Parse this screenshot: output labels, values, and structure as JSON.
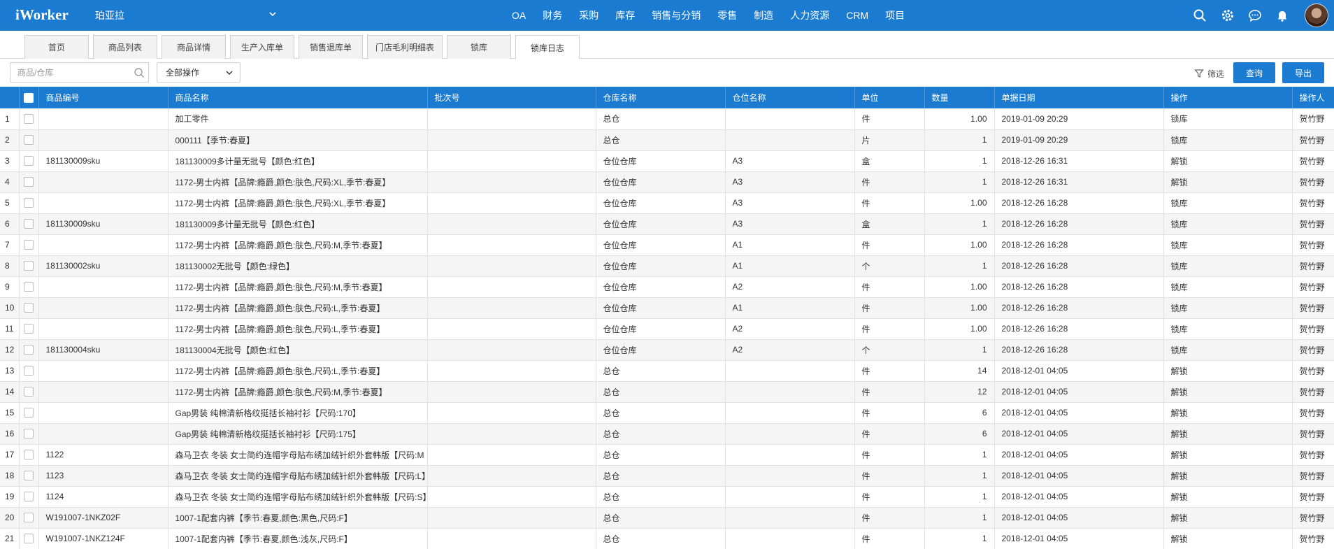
{
  "app": {
    "logo": "iWorker",
    "company": "珀亚拉",
    "nav": [
      "OA",
      "财务",
      "采购",
      "库存",
      "销售与分销",
      "零售",
      "制造",
      "人力资源",
      "CRM",
      "项目"
    ]
  },
  "tabs": [
    {
      "label": "首页",
      "active": false
    },
    {
      "label": "商品列表",
      "active": false
    },
    {
      "label": "商品详情",
      "active": false
    },
    {
      "label": "生产入库单",
      "active": false
    },
    {
      "label": "销售退库单",
      "active": false
    },
    {
      "label": "门店毛利明细表",
      "active": false
    },
    {
      "label": "锁库",
      "active": false
    },
    {
      "label": "锁库日志",
      "active": true
    }
  ],
  "toolbar": {
    "search_placeholder": "商品/仓库",
    "operation_select": "全部操作",
    "filter_label": "筛选",
    "query_label": "查询",
    "export_label": "导出"
  },
  "table": {
    "columns": [
      "商品编号",
      "商品名称",
      "批次号",
      "仓库名称",
      "仓位名称",
      "单位",
      "数量",
      "单据日期",
      "操作",
      "操作人"
    ],
    "rows": [
      {
        "no": "1",
        "code": "",
        "name": "加工零件",
        "batch": "",
        "warehouse": "总仓",
        "location": "",
        "unit": "件",
        "qty": "1.00",
        "date": "2019-01-09 20:29",
        "op": "锁库",
        "user": "贺竹野"
      },
      {
        "no": "2",
        "code": "",
        "name": "000111【季节:春夏】",
        "batch": "",
        "warehouse": "总仓",
        "location": "",
        "unit": "片",
        "qty": "1",
        "date": "2019-01-09 20:29",
        "op": "锁库",
        "user": "贺竹野"
      },
      {
        "no": "3",
        "code": "181130009sku",
        "name": "181130009多计量无批号【颜色:红色】",
        "batch": "",
        "warehouse": "仓位仓库",
        "location": "A3",
        "unit": "盒",
        "qty": "1",
        "date": "2018-12-26 16:31",
        "op": "解锁",
        "user": "贺竹野"
      },
      {
        "no": "4",
        "code": "",
        "name": "1172-男士内裤【品牌:瘾爵,颜色:肤色,尺码:XL,季节:春夏】",
        "batch": "",
        "warehouse": "仓位仓库",
        "location": "A3",
        "unit": "件",
        "qty": "1",
        "date": "2018-12-26 16:31",
        "op": "解锁",
        "user": "贺竹野"
      },
      {
        "no": "5",
        "code": "",
        "name": "1172-男士内裤【品牌:瘾爵,颜色:肤色,尺码:XL,季节:春夏】",
        "batch": "",
        "warehouse": "仓位仓库",
        "location": "A3",
        "unit": "件",
        "qty": "1.00",
        "date": "2018-12-26 16:28",
        "op": "锁库",
        "user": "贺竹野"
      },
      {
        "no": "6",
        "code": "181130009sku",
        "name": "181130009多计量无批号【颜色:红色】",
        "batch": "",
        "warehouse": "仓位仓库",
        "location": "A3",
        "unit": "盒",
        "qty": "1",
        "date": "2018-12-26 16:28",
        "op": "锁库",
        "user": "贺竹野"
      },
      {
        "no": "7",
        "code": "",
        "name": "1172-男士内裤【品牌:瘾爵,颜色:肤色,尺码:M,季节:春夏】",
        "batch": "",
        "warehouse": "仓位仓库",
        "location": "A1",
        "unit": "件",
        "qty": "1.00",
        "date": "2018-12-26 16:28",
        "op": "锁库",
        "user": "贺竹野"
      },
      {
        "no": "8",
        "code": "181130002sku",
        "name": "181130002无批号【颜色:绿色】",
        "batch": "",
        "warehouse": "仓位仓库",
        "location": "A1",
        "unit": "个",
        "qty": "1",
        "date": "2018-12-26 16:28",
        "op": "锁库",
        "user": "贺竹野"
      },
      {
        "no": "9",
        "code": "",
        "name": "1172-男士内裤【品牌:瘾爵,颜色:肤色,尺码:M,季节:春夏】",
        "batch": "",
        "warehouse": "仓位仓库",
        "location": "A2",
        "unit": "件",
        "qty": "1.00",
        "date": "2018-12-26 16:28",
        "op": "锁库",
        "user": "贺竹野"
      },
      {
        "no": "10",
        "code": "",
        "name": "1172-男士内裤【品牌:瘾爵,颜色:肤色,尺码:L,季节:春夏】",
        "batch": "",
        "warehouse": "仓位仓库",
        "location": "A1",
        "unit": "件",
        "qty": "1.00",
        "date": "2018-12-26 16:28",
        "op": "锁库",
        "user": "贺竹野"
      },
      {
        "no": "11",
        "code": "",
        "name": "1172-男士内裤【品牌:瘾爵,颜色:肤色,尺码:L,季节:春夏】",
        "batch": "",
        "warehouse": "仓位仓库",
        "location": "A2",
        "unit": "件",
        "qty": "1.00",
        "date": "2018-12-26 16:28",
        "op": "锁库",
        "user": "贺竹野"
      },
      {
        "no": "12",
        "code": "181130004sku",
        "name": "181130004无批号【颜色:红色】",
        "batch": "",
        "warehouse": "仓位仓库",
        "location": "A2",
        "unit": "个",
        "qty": "1",
        "date": "2018-12-26 16:28",
        "op": "锁库",
        "user": "贺竹野"
      },
      {
        "no": "13",
        "code": "",
        "name": "1172-男士内裤【品牌:瘾爵,颜色:肤色,尺码:L,季节:春夏】",
        "batch": "",
        "warehouse": "总仓",
        "location": "",
        "unit": "件",
        "qty": "14",
        "date": "2018-12-01 04:05",
        "op": "解锁",
        "user": "贺竹野"
      },
      {
        "no": "14",
        "code": "",
        "name": "1172-男士内裤【品牌:瘾爵,颜色:肤色,尺码:M,季节:春夏】",
        "batch": "",
        "warehouse": "总仓",
        "location": "",
        "unit": "件",
        "qty": "12",
        "date": "2018-12-01 04:05",
        "op": "解锁",
        "user": "贺竹野"
      },
      {
        "no": "15",
        "code": "",
        "name": "Gap男装 纯棉清新格纹挺括长袖衬衫【尺码:170】",
        "batch": "",
        "warehouse": "总仓",
        "location": "",
        "unit": "件",
        "qty": "6",
        "date": "2018-12-01 04:05",
        "op": "解锁",
        "user": "贺竹野"
      },
      {
        "no": "16",
        "code": "",
        "name": "Gap男装 纯棉清新格纹挺括长袖衬衫【尺码:175】",
        "batch": "",
        "warehouse": "总仓",
        "location": "",
        "unit": "件",
        "qty": "6",
        "date": "2018-12-01 04:05",
        "op": "解锁",
        "user": "贺竹野"
      },
      {
        "no": "17",
        "code": "1122",
        "name": "森马卫衣 冬装 女士简约连帽字母贴布绣加绒针织外套韩版【尺码:M",
        "batch": "",
        "warehouse": "总仓",
        "location": "",
        "unit": "件",
        "qty": "1",
        "date": "2018-12-01 04:05",
        "op": "解锁",
        "user": "贺竹野"
      },
      {
        "no": "18",
        "code": "1123",
        "name": "森马卫衣 冬装 女士简约连帽字母贴布绣加绒针织外套韩版【尺码:L】",
        "batch": "",
        "warehouse": "总仓",
        "location": "",
        "unit": "件",
        "qty": "1",
        "date": "2018-12-01 04:05",
        "op": "解锁",
        "user": "贺竹野"
      },
      {
        "no": "19",
        "code": "1124",
        "name": "森马卫衣 冬装 女士简约连帽字母贴布绣加绒针织外套韩版【尺码:S】",
        "batch": "",
        "warehouse": "总仓",
        "location": "",
        "unit": "件",
        "qty": "1",
        "date": "2018-12-01 04:05",
        "op": "解锁",
        "user": "贺竹野"
      },
      {
        "no": "20",
        "code": "W191007-1NKZ02F",
        "name": "1007-1配套内裤【季节:春夏,颜色:黑色,尺码:F】",
        "batch": "",
        "warehouse": "总仓",
        "location": "",
        "unit": "件",
        "qty": "1",
        "date": "2018-12-01 04:05",
        "op": "解锁",
        "user": "贺竹野"
      },
      {
        "no": "21",
        "code": "W191007-1NKZ124F",
        "name": "1007-1配套内裤【季节:春夏,颜色:浅灰,尺码:F】",
        "batch": "",
        "warehouse": "总仓",
        "location": "",
        "unit": "件",
        "qty": "1",
        "date": "2018-12-01 04:05",
        "op": "解锁",
        "user": "贺竹野"
      }
    ]
  },
  "icons": {
    "search": "search-icon",
    "settings": "gear-icon",
    "chat": "chat-icon",
    "notifications": "bell-icon",
    "filter": "filter-icon"
  },
  "colors": {
    "primary": "#1b7bd1"
  }
}
